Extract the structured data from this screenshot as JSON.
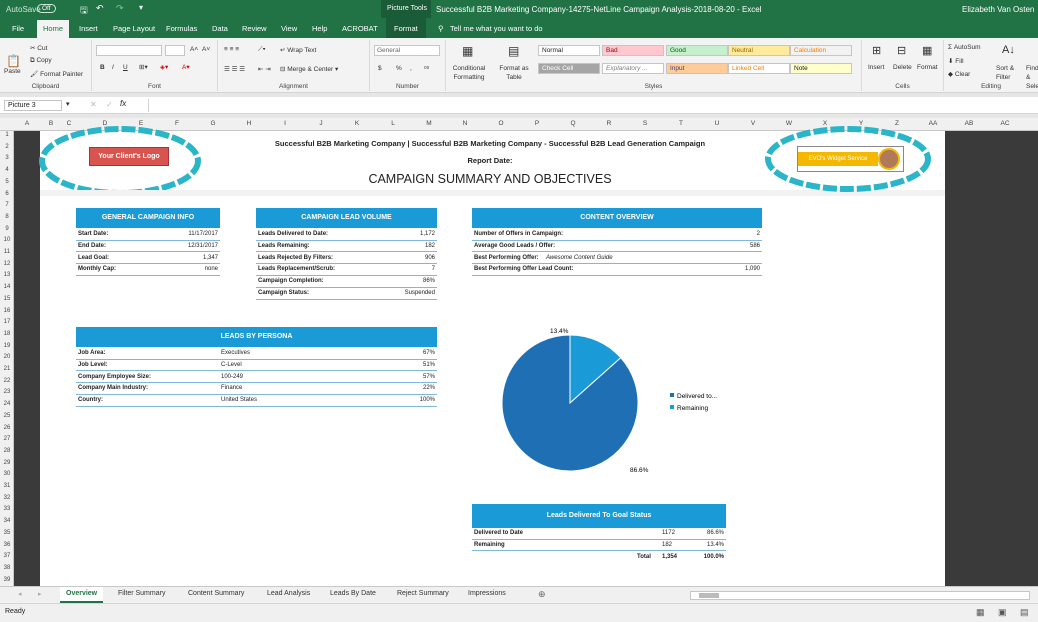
{
  "titlebar": {
    "autosave": "AutoSave",
    "autosave_state": "Off",
    "picture_tools": "Picture Tools",
    "doc_title": "Successful B2B Marketing Company-14275-NetLine Campaign Analysis-2018-08-20  -  Excel",
    "user": "Elizabeth Van Osten"
  },
  "menu": [
    "File",
    "Home",
    "Insert",
    "Page Layout",
    "Formulas",
    "Data",
    "Review",
    "View",
    "Help",
    "ACROBAT",
    "Format"
  ],
  "tell_me": "Tell me what you want to do",
  "ribbon": {
    "clipboard": {
      "label": "Clipboard",
      "cut": "Cut",
      "copy": "Copy",
      "paste": "Paste",
      "format_painter": "Format Painter"
    },
    "font": {
      "label": "Font",
      "bold": "B",
      "italic": "I",
      "underline": "U",
      "grow": "A˄",
      "shrink": "A˅"
    },
    "alignment": {
      "label": "Alignment",
      "wrap": "Wrap Text",
      "merge": "Merge & Center"
    },
    "number": {
      "label": "Number",
      "format": "General",
      "currency": "$",
      "percent": "%",
      "comma": ","
    },
    "styles": {
      "label": "Styles",
      "conditional": "Conditional Formatting",
      "format_table": "Format as Table",
      "cells": [
        "Normal",
        "Bad",
        "Good",
        "Neutral",
        "Calculation",
        "Check Cell",
        "Explanatory ...",
        "Input",
        "Linked Cell",
        "Note"
      ]
    },
    "cells": {
      "label": "Cells",
      "insert": "Insert",
      "delete": "Delete",
      "format": "Format"
    },
    "editing": {
      "label": "Editing",
      "autosum": "AutoSum",
      "fill": "Fill",
      "clear": "Clear",
      "sort": "Sort & Filter",
      "find": "Find & Select"
    }
  },
  "namebox": "Picture 3",
  "fx": "fx",
  "columns": [
    "A",
    "B",
    "C",
    "D",
    "E",
    "F",
    "G",
    "H",
    "I",
    "J",
    "K",
    "L",
    "M",
    "N",
    "O",
    "P",
    "Q",
    "R",
    "S",
    "T",
    "U",
    "V",
    "W",
    "X",
    "Y",
    "Z",
    "AA",
    "AB",
    "AC"
  ],
  "rows": [
    "1",
    "2",
    "3",
    "4",
    "5",
    "6",
    "7",
    "8",
    "9",
    "10",
    "11",
    "12",
    "13",
    "14",
    "15",
    "16",
    "17",
    "18",
    "19",
    "20",
    "21",
    "22",
    "23",
    "24",
    "25",
    "26",
    "27",
    "28",
    "29",
    "30",
    "31",
    "32",
    "33",
    "34",
    "35",
    "36",
    "37",
    "38",
    "39"
  ],
  "header": {
    "logo_button": "Your Client's Logo",
    "company_line": "Successful B2B Marketing Company |  Successful B2B Marketing Company - Successful B2B Lead Generation Campaign",
    "report_date": "Report Date:",
    "title": "CAMPAIGN SUMMARY AND OBJECTIVES",
    "widget": "EVO's Widget Service"
  },
  "general": {
    "title": "GENERAL CAMPAIGN INFO",
    "rows": [
      {
        "label": "Start Date:",
        "value": "11/17/2017"
      },
      {
        "label": "End Date:",
        "value": "12/31/2017"
      },
      {
        "label": "Lead Goal:",
        "value": "1,347"
      },
      {
        "label": "Monthly Cap:",
        "value": "none"
      }
    ]
  },
  "volume": {
    "title": "CAMPAIGN LEAD VOLUME",
    "rows": [
      {
        "label": "Leads Delivered to Date:",
        "value": "1,172"
      },
      {
        "label": "Leads Remaining:",
        "value": "182"
      },
      {
        "label": "Leads Rejected By Filters:",
        "value": "906"
      },
      {
        "label": "Leads Replacement/Scrub:",
        "value": "7"
      },
      {
        "label": "Campaign Completion:",
        "value": "86%"
      },
      {
        "label": "Campaign Status:",
        "value": "Suspended"
      }
    ]
  },
  "content": {
    "title": "CONTENT OVERVIEW",
    "rows": [
      {
        "label": "Number of Offers in Campaign:",
        "mid": "",
        "value": "2"
      },
      {
        "label": "Average Good Leads / Offer:",
        "mid": "",
        "value": "586"
      },
      {
        "label": "Best Performing Offer:",
        "mid": "Awesome Content Guide",
        "value": ""
      },
      {
        "label": "Best Performing Offer Lead Count:",
        "mid": "",
        "value": "1,090"
      }
    ]
  },
  "persona": {
    "title": "LEADS BY PERSONA",
    "rows": [
      {
        "label": "Job Area:",
        "mid": "Executives",
        "value": "67%"
      },
      {
        "label": "Job Level:",
        "mid": "C-Level",
        "value": "51%"
      },
      {
        "label": "Company Employee Size:",
        "mid": "100-249",
        "value": "57%"
      },
      {
        "label": "Company Main Industry:",
        "mid": "Finance",
        "value": "22%"
      },
      {
        "label": "Country:",
        "mid": "United States",
        "value": "100%"
      }
    ]
  },
  "chart_data": {
    "type": "pie",
    "slices": [
      {
        "name": "Delivered to...",
        "value": 86.6,
        "label": "86.6%",
        "color": "#1f6fb5"
      },
      {
        "name": "Remaining",
        "value": 13.4,
        "label": "13.4%",
        "color": "#1a9ad6"
      }
    ],
    "legend_position": "right"
  },
  "goal": {
    "title": "Leads Delivered To Goal Status",
    "rows": [
      {
        "label": "Delivered to Date",
        "count": "1172",
        "pct": "86.6%"
      },
      {
        "label": "Remaining",
        "count": "182",
        "pct": "13.4%"
      }
    ],
    "total_label": "Total",
    "total_count": "1,354",
    "total_pct": "100.0%"
  },
  "tabs": [
    "Overview",
    "Filter Summary",
    "Content Summary",
    "Lead Analysis",
    "Leads By Date",
    "Reject Summary",
    "Impressions"
  ],
  "status": "Ready",
  "colors": {
    "excel_green": "#217346",
    "header_blue": "#1a9ad6",
    "logo_red": "#d9534f",
    "widget_yellow": "#f5b800",
    "highlight": "#2bb5c9"
  }
}
